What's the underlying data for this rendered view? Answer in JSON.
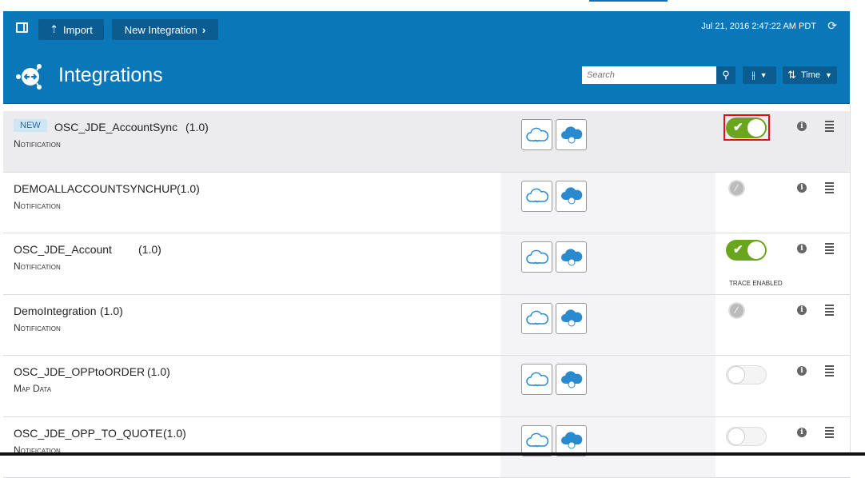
{
  "header": {
    "import_label": "Import",
    "new_integration_label": "New Integration",
    "timestamp": "Jul 21, 2016 2:47:22 AM PDT",
    "title": "Integrations",
    "search_placeholder": "Search",
    "sort_label": "Time"
  },
  "rows": [
    {
      "badge": "NEW",
      "name": "OSC_JDE_AccountSync",
      "version": "(1.0)",
      "type": "Notification",
      "status": "active",
      "trace": ""
    },
    {
      "name": "DEMOALLACCOUNTSYNCHUP",
      "version": "(1.0)",
      "type": "Notification",
      "status": "disabled",
      "trace": ""
    },
    {
      "name": "OSC_JDE_Account",
      "version": "(1.0)",
      "type": "Notification",
      "status": "active",
      "trace": "TRACE ENABLED"
    },
    {
      "name": "DemoIntegration",
      "version": "(1.0)",
      "type": "Notification",
      "status": "disabled",
      "trace": ""
    },
    {
      "name": "OSC_JDE_OPPtoORDER",
      "version": "(1.0)",
      "type": "Map Data",
      "status": "inactive",
      "trace": ""
    },
    {
      "name": "OSC_JDE_OPP_TO_QUOTE",
      "version": "(1.0)",
      "type": "Notification",
      "status": "inactive",
      "trace": ""
    }
  ],
  "colors": {
    "header": "#0a78b8",
    "toggle_on": "#6aa51e",
    "highlight": "#e01010"
  }
}
